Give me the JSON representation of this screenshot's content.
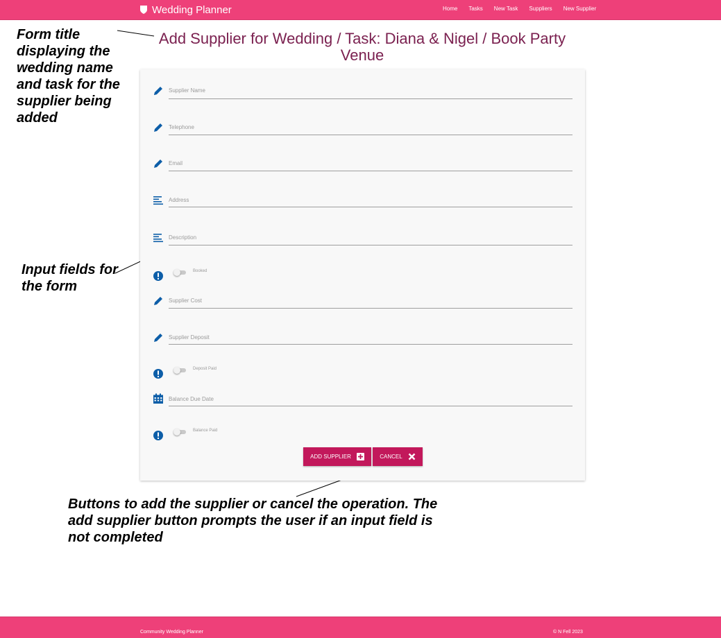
{
  "navbar": {
    "brand": "Wedding Planner",
    "links": [
      "Home",
      "Tasks",
      "New Task",
      "Suppliers",
      "New Supplier"
    ]
  },
  "form": {
    "title_line1": "Add Supplier for Wedding / Task: Diana & Nigel / Book Party",
    "title_line2": "Venue",
    "fields": {
      "supplier_name": "Supplier Name",
      "telephone": "Telephone",
      "email": "Email",
      "address": "Address",
      "description": "Description",
      "booked": "Booked",
      "supplier_cost": "Supplier Cost",
      "supplier_deposit": "Supplier Deposit",
      "deposit_paid": "Deposit Paid",
      "balance_due_date": "Balance Due Date",
      "balance_paid": "Balance Paid"
    },
    "buttons": {
      "add": "ADD SUPPLIER",
      "cancel": "CANCEL"
    }
  },
  "annotations": {
    "title": "Form title displaying the wedding name and task for the supplier being added",
    "inputs": "Input fields for the form",
    "buttons": "Buttons to add the supplier or cancel the operation. The add supplier button prompts the user if an input field is not completed"
  },
  "footer": {
    "left": "Community Wedding Planner",
    "right": "© N Fell 2023"
  },
  "colors": {
    "brand_pink": "#ee4079",
    "button": "#c2185b",
    "title": "#7b2150",
    "icon_blue": "#0d5ea8"
  }
}
